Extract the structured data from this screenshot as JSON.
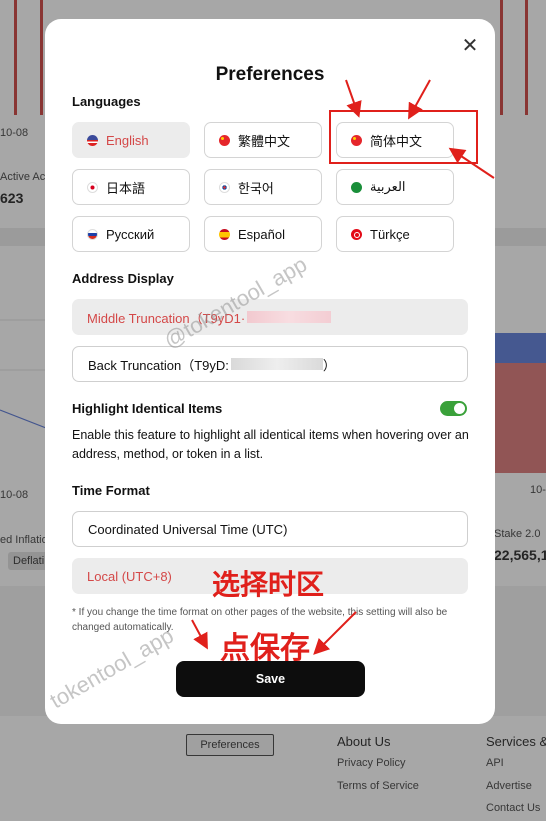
{
  "background": {
    "tick_left_top": "10-08",
    "active_label": "Active Acc",
    "active_value": "623",
    "tick_left_mid": "10-08",
    "tick_right_mid": "10-0",
    "inflation_label": "ed Inflatio",
    "deflation_pill": "Deflati",
    "stake_label": "Stake 2.0",
    "stake_value": "22,565,1",
    "footer_button": "Preferences",
    "about_heading": "About Us",
    "about_links": [
      "Privacy Policy",
      "Terms of Service"
    ],
    "services_heading": "Services &",
    "services_links": [
      "API",
      "Advertise",
      "Contact Us"
    ]
  },
  "modal": {
    "title": "Preferences",
    "close_glyph": "✕",
    "languages_label": "Languages",
    "languages": [
      {
        "label": "English",
        "flag": "us-flag-icon",
        "active": true
      },
      {
        "label": "繁體中文",
        "flag": "cn-flag-icon",
        "active": false
      },
      {
        "label": "简体中文",
        "flag": "cn-flag-icon",
        "active": false
      },
      {
        "label": "日本語",
        "flag": "jp-flag-icon",
        "active": false
      },
      {
        "label": "한국어",
        "flag": "kr-flag-icon",
        "active": false
      },
      {
        "label": "العربية",
        "flag": "sa-flag-icon",
        "active": false
      },
      {
        "label": "Русский",
        "flag": "ru-flag-icon",
        "active": false
      },
      {
        "label": "Español",
        "flag": "es-flag-icon",
        "active": false
      },
      {
        "label": "Türkçe",
        "flag": "tr-flag-icon",
        "active": false
      }
    ],
    "address_label": "Address Display",
    "address_options": [
      {
        "prefix": "Middle Truncation（T9yD1·",
        "suffix": "",
        "selected": true
      },
      {
        "prefix": "Back Truncation（T9yD:",
        "suffix": "）",
        "selected": false
      }
    ],
    "highlight_label": "Highlight Identical Items",
    "highlight_enabled": true,
    "highlight_desc": "Enable this feature to highlight all identical items when hovering over an address, method, or token in a list.",
    "time_label": "Time Format",
    "time_options": [
      {
        "label": "Coordinated Universal Time (UTC)",
        "selected": false
      },
      {
        "label": "Local (UTC+8)",
        "selected": true
      }
    ],
    "note": "* If you change the time format on other pages of the website, this setting will also be changed automatically.",
    "save_label": "Save"
  },
  "annotations": {
    "select_timezone": "选择时区",
    "click_save": "点保存",
    "watermark_1": "@tokentool_app",
    "watermark_2": "tokentool_app",
    "accent_color": "#e0201b"
  },
  "colors": {
    "active_text": "#d44848",
    "toggle_on": "#3aa13a",
    "save_bg": "#0d0d0d"
  }
}
